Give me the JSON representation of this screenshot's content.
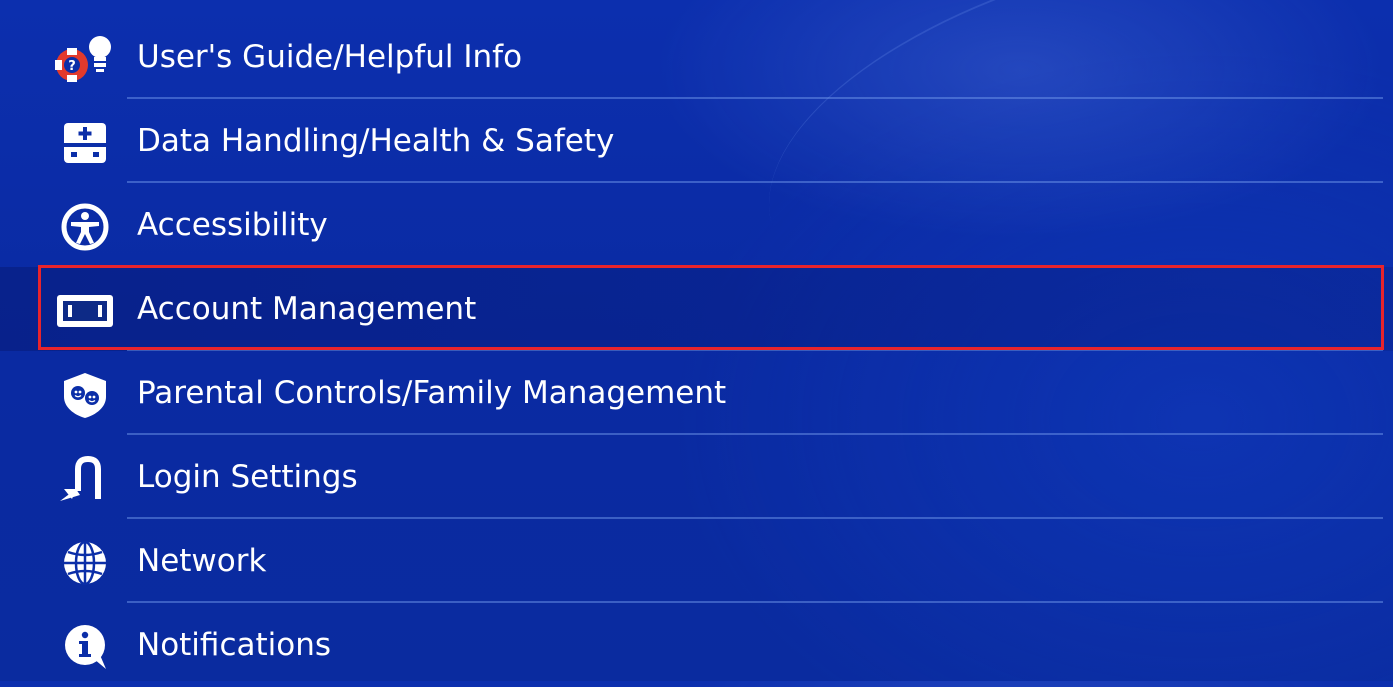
{
  "settings_menu": {
    "items": [
      {
        "label": "User's Guide/Helpful Info",
        "icon": "lifebuoy-lightbulb-icon"
      },
      {
        "label": "Data Handling/Health & Safety",
        "icon": "first-aid-kit-icon"
      },
      {
        "label": "Accessibility",
        "icon": "accessibility-icon"
      },
      {
        "label": "Account Management",
        "icon": "id-card-icon",
        "selected": true
      },
      {
        "label": "Parental Controls/Family Management",
        "icon": "shield-faces-icon"
      },
      {
        "label": "Login Settings",
        "icon": "login-arrow-icon"
      },
      {
        "label": "Network",
        "icon": "globe-icon"
      },
      {
        "label": "Notifications",
        "icon": "info-bubble-icon"
      }
    ]
  },
  "colors": {
    "background": "#0b2ea8",
    "text": "#ffffff",
    "highlight_border": "#e8242c",
    "lifebuoy_red": "#e23a2c"
  }
}
